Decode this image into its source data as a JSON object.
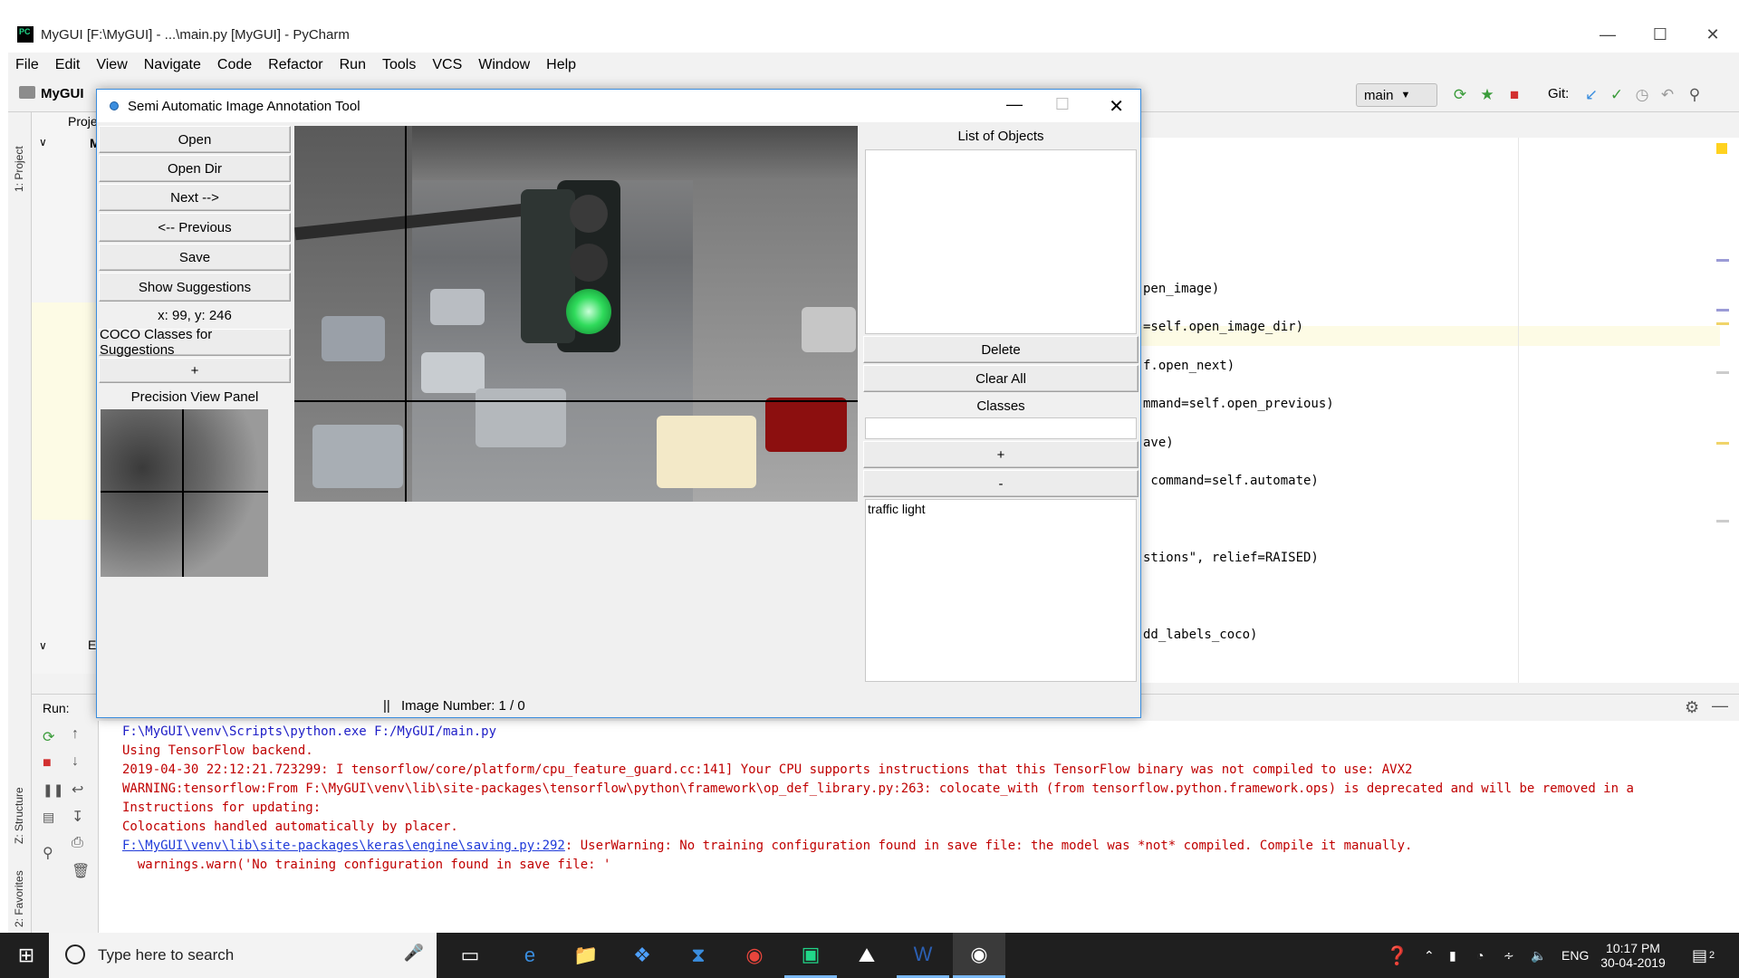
{
  "pycharm": {
    "title": "MyGUI [F:\\MyGUI] - ...\\main.py [MyGUI] - PyCharm",
    "menu": [
      "File",
      "Edit",
      "View",
      "Navigate",
      "Code",
      "Refactor",
      "Run",
      "Tools",
      "VCS",
      "Window",
      "Help"
    ],
    "project_name": "MyGUI",
    "branch": "main",
    "git_label": "Git:",
    "project_tab": "1: Project",
    "structure_tab": "Z: Structure",
    "favorites_tab": "2: Favorites",
    "project_tree_root": "My",
    "project_tree_label": "Proje",
    "external_label": "Ext",
    "code_lines": [
      "pen_image)",
      "=self.open_image_dir)",
      "f.open_next)",
      "mmand=self.open_previous)",
      "ave)",
      " command=self.automate)",
      "stions\", relief=RAISED)",
      "dd_labels_coco)"
    ],
    "run_label": "Run:",
    "console": [
      "F:\\MyGUI\\venv\\Scripts\\python.exe F:/MyGUI/main.py",
      "Using TensorFlow backend.",
      "2019-04-30 22:12:21.723299: I tensorflow/core/platform/cpu_feature_guard.cc:141] Your CPU supports instructions that this TensorFlow binary was not compiled to use: AVX2",
      "WARNING:tensorflow:From F:\\MyGUI\\venv\\lib\\site-packages\\tensorflow\\python\\framework\\op_def_library.py:263: colocate_with (from tensorflow.python.framework.ops) is deprecated and will be removed in a",
      "Instructions for updating:",
      "Colocations handled automatically by placer.",
      "",
      "  warnings.warn('No training configuration found in save file: '"
    ],
    "console_link": "F:\\MyGUI\\venv\\lib\\site-packages\\keras\\engine\\saving.py:292",
    "console_link_rest": ": UserWarning: No training configuration found in save file: the model was *not* compiled. Compile it manually."
  },
  "annotation_tool": {
    "title": "Semi Automatic Image Annotation Tool",
    "buttons": {
      "open": "Open",
      "open_dir": "Open Dir",
      "next": "Next -->",
      "previous": "<-- Previous",
      "save": "Save",
      "show_suggestions": "Show Suggestions",
      "coco_classes": "COCO Classes for Suggestions",
      "plus_left": "+",
      "delete": "Delete",
      "clear_all": "Clear All",
      "plus_right": "+",
      "minus_right": "-"
    },
    "coords": "x: 99, y: 246",
    "precision_label": "Precision View Panel",
    "list_of_objects_label": "List of Objects",
    "classes_label": "Classes",
    "classes_input": "",
    "class_list": [
      "traffic light"
    ],
    "status": "Image Number: 1 / 0",
    "status_sep": "||"
  },
  "taskbar": {
    "search_placeholder": "Type here to search",
    "language": "ENG",
    "time": "10:17 PM",
    "date": "30-04-2019",
    "notifications": "2"
  }
}
